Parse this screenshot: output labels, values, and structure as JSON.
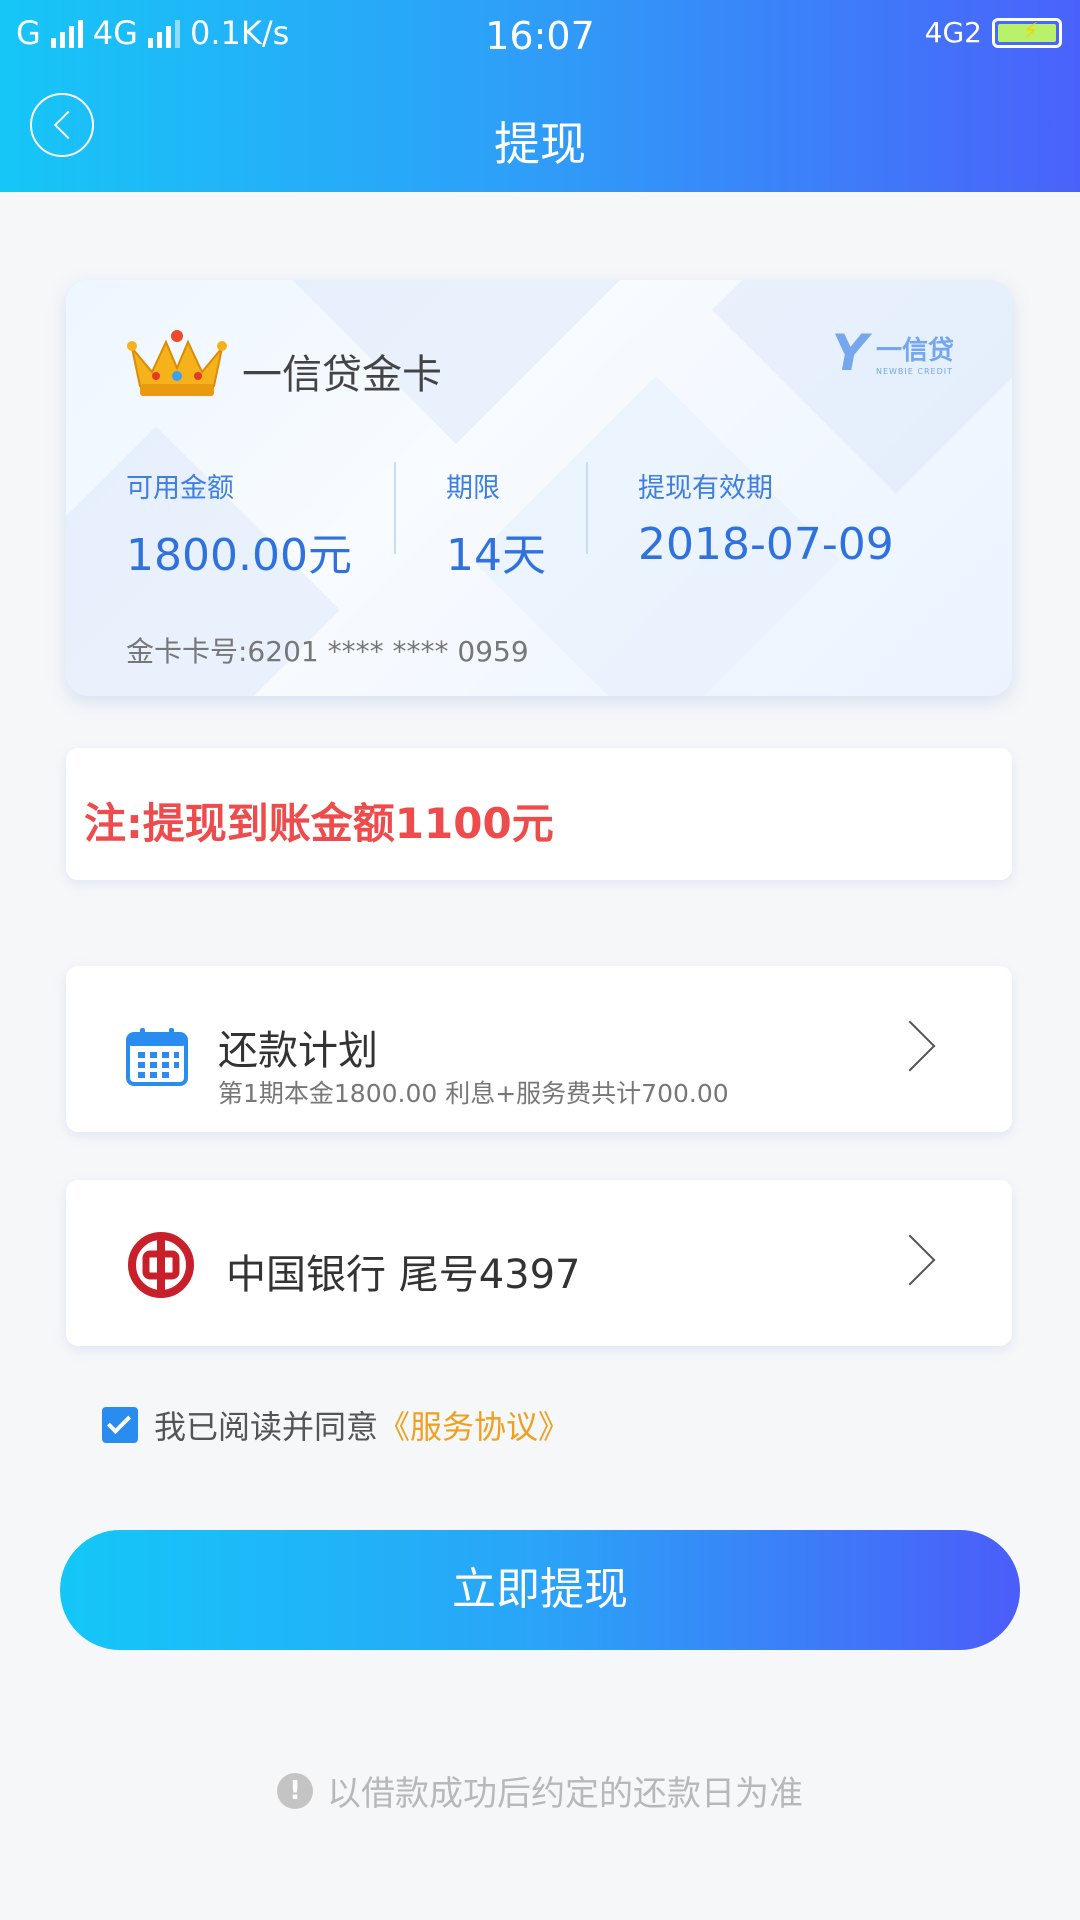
{
  "status_bar": {
    "carrier1": "G",
    "carrier2": "4G",
    "speed": "0.1K/s",
    "time": "16:07",
    "network": "4G2"
  },
  "header": {
    "title": "提现",
    "back_icon": "chevron-left-icon"
  },
  "card": {
    "title": "一信贷金卡",
    "brand_name": "一信贷",
    "brand_sub": "NEWBIE CREDIT",
    "available_label": "可用金额",
    "available_value": "1800.00元",
    "term_label": "期限",
    "term_value": "14天",
    "valid_label": "提现有效期",
    "valid_value": "2018-07-09",
    "card_number": "金卡卡号:6201 **** **** 0959"
  },
  "note": {
    "text": "注:提现到账金额1100元"
  },
  "plan": {
    "title": "还款计划",
    "subtitle": "第1期本金1800.00  利息+服务费共计700.00",
    "icon": "calendar-icon"
  },
  "bank": {
    "name": "中国银行 尾号4397",
    "icon": "bank-of-china-icon"
  },
  "agreement": {
    "checked": true,
    "text": "我已阅读并同意",
    "link": "《服务协议》"
  },
  "cta": {
    "label": "立即提现"
  },
  "tip": {
    "text": "以借款成功后约定的还款日为准"
  },
  "colors": {
    "header_start": "#16c6f7",
    "header_end": "#4a62fb",
    "accent_blue": "#2f72de",
    "warning_red": "#ee4c4c",
    "link_orange": "#f0a020"
  }
}
